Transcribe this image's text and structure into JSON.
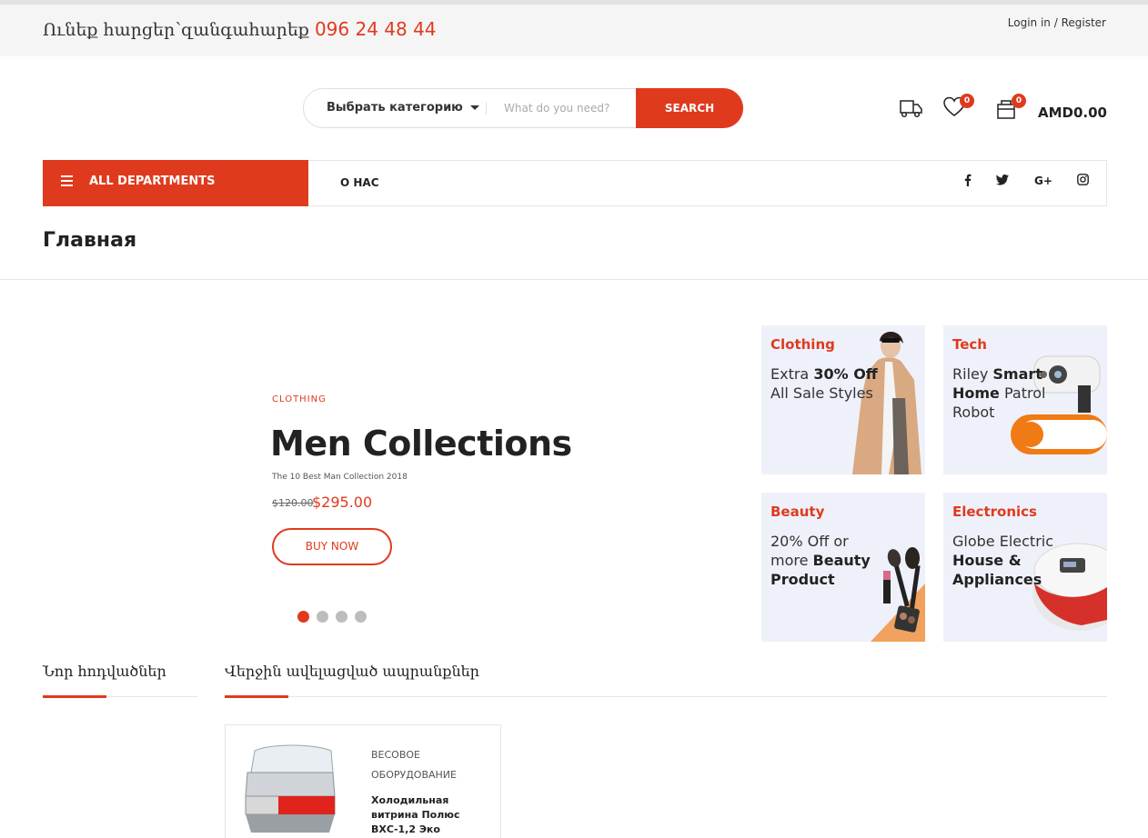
{
  "topbar": {
    "question_text": "Ունեք հարցեր՝զանգահարեք",
    "phone": "096 24 48 44",
    "login_register": "Login in / Register"
  },
  "search": {
    "category_label": "Выбрать категорию",
    "placeholder": "What do you need?",
    "button_label": "SEARCH"
  },
  "header": {
    "wishlist_count": "0",
    "cart_count": "0",
    "cart_total": "AMD0.00"
  },
  "nav": {
    "departments_label": "ALL DEPARTMENTS",
    "links": [
      "О НАС"
    ],
    "social": [
      "f",
      "t",
      "G+",
      "ig"
    ]
  },
  "page": {
    "title": "Главная"
  },
  "slider": {
    "category": "CLOTHING",
    "title": "Men Collections",
    "subtitle": "The 10 Best Man Collection 2018",
    "old_price": "$120.00",
    "new_price": "$295.00",
    "button_label": "BUY NOW",
    "dots": 4,
    "active_dot": 0
  },
  "promos": [
    {
      "title": "Clothing",
      "pre": "Extra ",
      "bold": "30% Off",
      "post": " All Sale Styles"
    },
    {
      "title": "Tech",
      "pre": "Riley ",
      "bold": "Smart Home",
      "post": " Patrol Robot"
    },
    {
      "title": "Beauty",
      "pre": "20% Off or more ",
      "bold": "Beauty Product",
      "post": ""
    },
    {
      "title": "Electronics",
      "pre": "Globe Electric ",
      "bold": "House & Appliances",
      "post": ""
    }
  ],
  "sections": {
    "news_title": "Նոր հոդվածներ",
    "latest_title": "Վերջին ավելացված ապրանքներ"
  },
  "product": {
    "category": "ВЕСОВОЕ ОБОРУДОВАНИЕ",
    "name": "Холодильная витрина Полюс ВХС-1,2 Эко"
  },
  "colors": {
    "accent": "#e03a1e",
    "promo_bg": "#eff1fa",
    "topbar_bg": "#f5f5f5"
  }
}
